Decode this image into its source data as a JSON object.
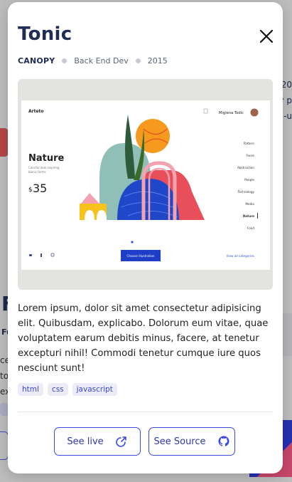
{
  "modal": {
    "title": "Tonic",
    "meta": {
      "client": "CANOPY",
      "role": "Back End Dev",
      "year": "2015"
    },
    "description": "Lorem ipsum, dolor sit amet consectetur adipisicing elit. Quibusdam, explicabo. Dolorum eum vitae, quae voluptatem earum debitis minus, facere, at tenetur excepturi nihil! Commodi tenetur cumque iure quos nesciunt sunt!",
    "tags": [
      "html",
      "css",
      "javascript"
    ],
    "buttons": {
      "live": "See live",
      "source": "See Source"
    }
  },
  "preview": {
    "brand": "Arteto",
    "user_name": "Miglena Todic",
    "hero_title": "Nature",
    "hero_sub_line1": "Colorful look inspiring",
    "hero_sub_line2": "bionic forms",
    "price_currency": "$",
    "price_value": "35",
    "categories": [
      "Pattern",
      "Faces",
      "Abstraction",
      "People",
      "Technology",
      "Media",
      "Nature",
      "Food"
    ],
    "active_category": "Nature",
    "cta": "Choose Illustration",
    "view_all": "View all categories"
  },
  "background": {
    "heading_fragment": "F",
    "sub_fragment": "Fu",
    "text_lines": [
      "ce",
      "to",
      "ex"
    ],
    "right_fragment_lines": [
      "20",
      "y p",
      "-u"
    ],
    "button_fragment": "ct"
  },
  "colors": {
    "title": "#1f2d54",
    "accent": "#3b49e0",
    "tag_bg": "#ececf9",
    "overlay": "rgba(0,0,0,0.22)"
  },
  "icons": {
    "close": "close-icon",
    "external": "external-link-icon",
    "github": "github-icon"
  }
}
